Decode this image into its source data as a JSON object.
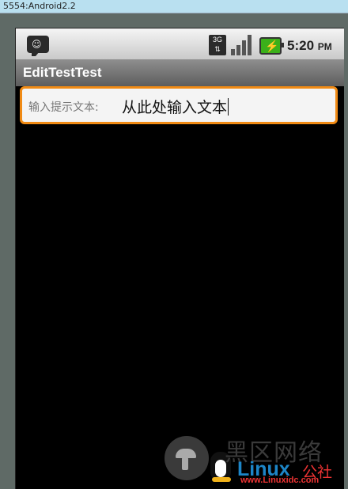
{
  "window": {
    "title": "5554:Android2.2"
  },
  "statusbar": {
    "network_label": "3G",
    "time": "5:20",
    "ampm": "PM",
    "battery_color": "#3bb01a"
  },
  "app": {
    "title": "EditTestTest"
  },
  "edit": {
    "label": "输入提示文本:",
    "value": "从此处输入文本",
    "focus_color": "#f08a14"
  },
  "watermark": {
    "cn_text": "黑区网络",
    "brand": "Linux",
    "brand_suffix": "公社",
    "url": "www.Linuxidc.com"
  }
}
